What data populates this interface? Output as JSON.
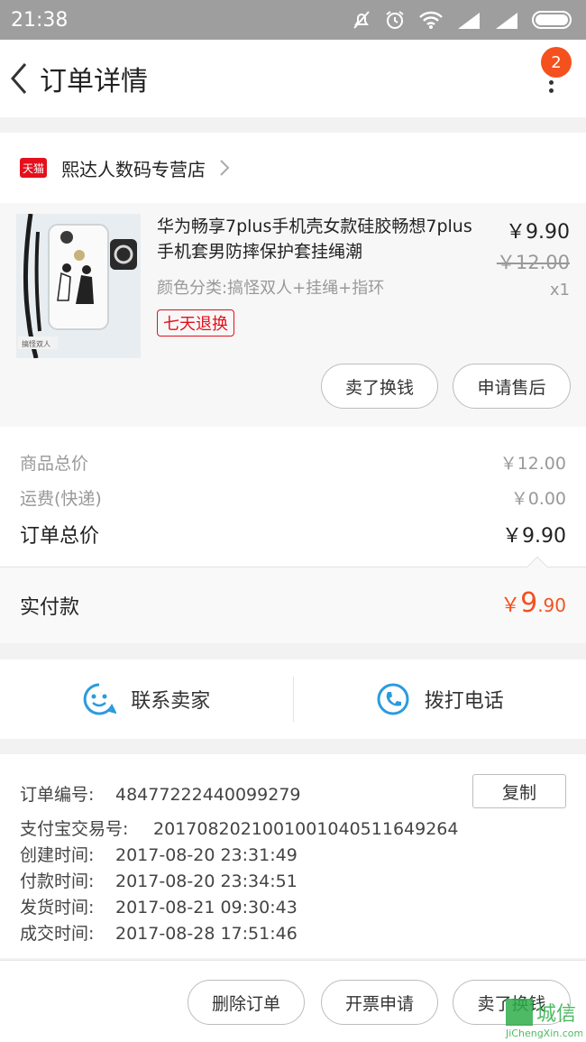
{
  "status_bar": {
    "time": "21:38"
  },
  "nav": {
    "title": "订单详情",
    "badge_count": "2"
  },
  "shop": {
    "badge": "天猫",
    "name": "熙达人数码专营店"
  },
  "product": {
    "title": "华为畅享7plus手机壳女款硅胶畅想7plus手机套男防摔保护套挂绳潮",
    "spec": "颜色分类:搞怪双人+挂绳+指环",
    "tag": "七天退换",
    "price": "￥9.90",
    "original_price": "￥12.00",
    "quantity": "x1",
    "thumb_caption": "搞怪双人",
    "actions": [
      "卖了换钱",
      "申请售后"
    ]
  },
  "summary": {
    "rows": [
      {
        "label": "商品总价",
        "value": "￥12.00"
      },
      {
        "label": "运费(快递)",
        "value": "￥0.00"
      },
      {
        "label": "订单总价",
        "value": "￥9.90"
      }
    ],
    "paid_label": "实付款",
    "paid_currency": "￥",
    "paid_integer": "9",
    "paid_decimal": ".90"
  },
  "contact": {
    "seller": "联系卖家",
    "phone": "拨打电话"
  },
  "order_info": {
    "copy_label": "复制",
    "lines": [
      {
        "label": "订单编号:",
        "value": "48477222440099279"
      },
      {
        "label": "支付宝交易号:",
        "value": "2017082021001001040511649264"
      },
      {
        "label": "创建时间:",
        "value": "2017-08-20 23:31:49"
      },
      {
        "label": "付款时间:",
        "value": "2017-08-20 23:34:51"
      },
      {
        "label": "发货时间:",
        "value": "2017-08-21 09:30:43"
      },
      {
        "label": "成交时间:",
        "value": "2017-08-28 17:51:46"
      }
    ]
  },
  "bottom_actions": [
    "删除订单",
    "开票申请",
    "卖了换钱"
  ],
  "watermark": {
    "text": "城信",
    "url": "JiChengXin.com"
  },
  "colors": {
    "accent": "#f4511e",
    "tmall_red": "#e4101c",
    "contact_blue": "#2b9bde"
  }
}
